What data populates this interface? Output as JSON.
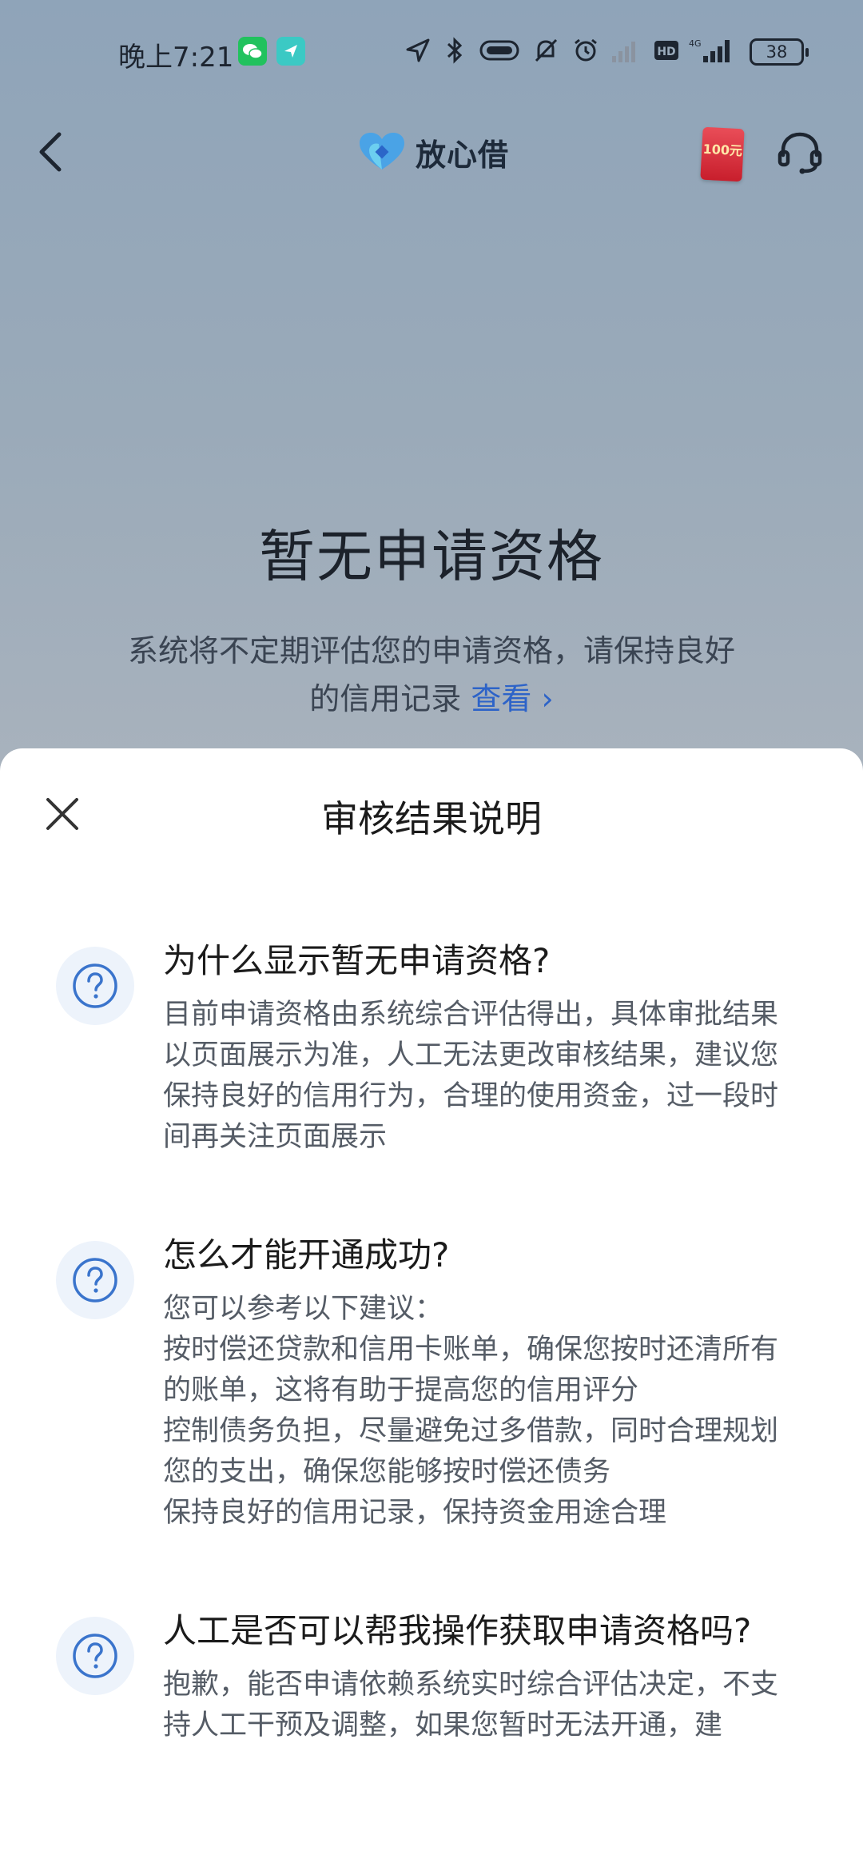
{
  "status_bar": {
    "time": "晚上7:21",
    "battery": "38"
  },
  "nav": {
    "brand_name": "放心借",
    "red_packet_label": "100元"
  },
  "hero": {
    "title": "暂无申请资格",
    "description": "系统将不定期评估您的申请资格，请保持良好的信用记录",
    "link_label": "查看",
    "link_chevron": "›"
  },
  "sheet": {
    "title": "审核结果说明",
    "faq": [
      {
        "question": "为什么显示暂无申请资格?",
        "answer_lines": [
          "目前申请资格由系统综合评估得出，具体审批结果以页面展示为准，人工无法更改审核结果，建议您保持良好的信用行为，合理的使用资金，过一段时间再关注页面展示"
        ]
      },
      {
        "question": "怎么才能开通成功?",
        "answer_lines": [
          "您可以参考以下建议：",
          "按时偿还贷款和信用卡账单，确保您按时还清所有的账单，这将有助于提高您的信用评分",
          "控制债务负担，尽量避免过多借款，同时合理规划您的支出，确保您能够按时偿还债务",
          "保持良好的信用记录，保持资金用途合理"
        ]
      },
      {
        "question": "人工是否可以帮我操作获取申请资格吗?",
        "answer_lines": [
          "抱歉，能否申请依赖系统实时综合评估决定，不支持人工干预及调整，如果您暂时无法开通，建"
        ]
      }
    ]
  },
  "colors": {
    "accent": "#2d63c8",
    "icon_blue": "#3a74cc",
    "red_packet": "#d62a38"
  }
}
